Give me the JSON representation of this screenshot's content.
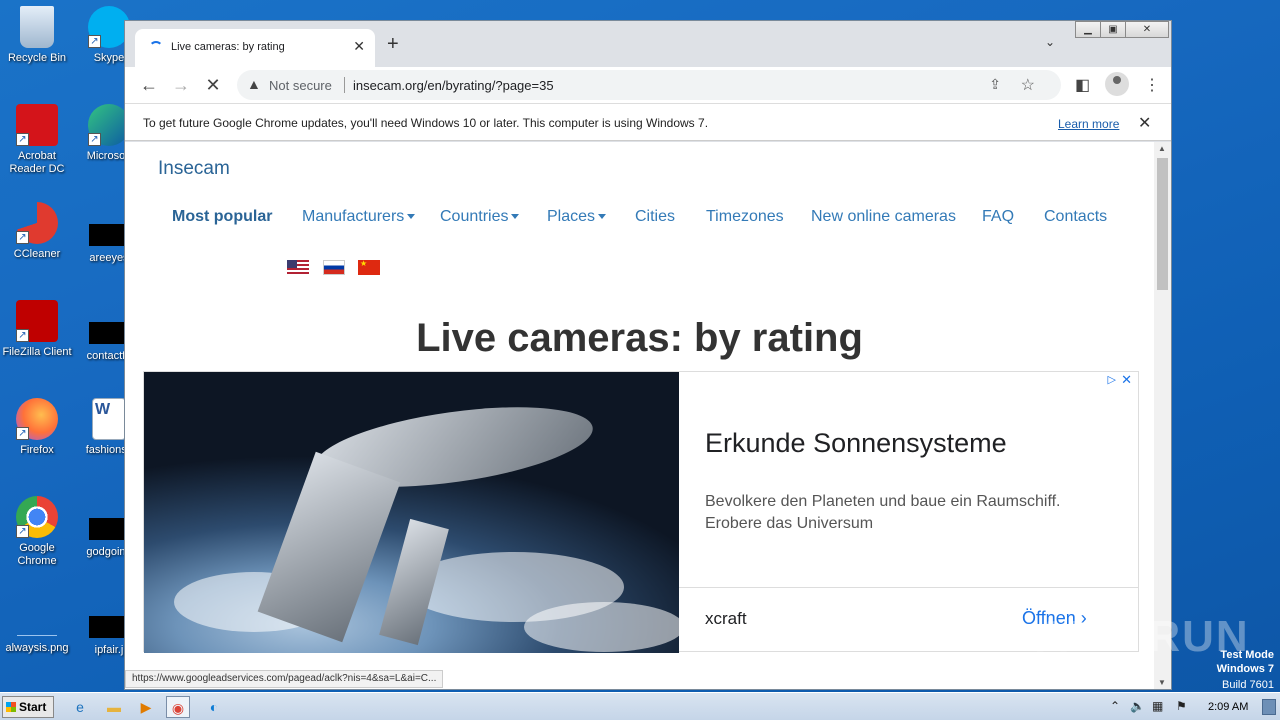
{
  "desktop": {
    "icons": [
      {
        "label": "Recycle Bin"
      },
      {
        "label": "Skype"
      },
      {
        "label": "Acrobat Reader DC"
      },
      {
        "label": "Microsoft"
      },
      {
        "label": "CCleaner"
      },
      {
        "label": "areeyes"
      },
      {
        "label": "FileZilla Client"
      },
      {
        "label": "contactfri"
      },
      {
        "label": "Firefox"
      },
      {
        "label": "fashionsy"
      },
      {
        "label": "Google Chrome"
      },
      {
        "label": "godgoing"
      },
      {
        "label": "alwaysis.png"
      },
      {
        "label": "ipfair.j"
      }
    ]
  },
  "browser": {
    "tab_title": "Live cameras: by rating",
    "security_label": "Not secure",
    "url": "insecam.org/en/byrating/?page=35",
    "infobar_message": "To get future Google Chrome updates, you'll need Windows 10 or later. This computer is using Windows 7.",
    "infobar_link": "Learn more",
    "status_url": "https://www.googleadservices.com/pagead/aclk?nis=4&sa=L&ai=C..."
  },
  "site": {
    "brand": "Insecam",
    "nav": [
      {
        "label": "Most popular"
      },
      {
        "label": "Manufacturers"
      },
      {
        "label": "Countries"
      },
      {
        "label": "Places"
      },
      {
        "label": "Cities"
      },
      {
        "label": "Timezones"
      },
      {
        "label": "New online cameras"
      },
      {
        "label": "FAQ"
      },
      {
        "label": "Contacts"
      }
    ],
    "heading": "Live cameras: by rating"
  },
  "ad": {
    "title": "Erkunde Sonnensysteme",
    "text": "Bevolkere den Planeten und baue ein Raumschiff. Erobere das Universum",
    "brand": "xcraft",
    "cta": "Öffnen"
  },
  "taskbar": {
    "start_label": "Start",
    "clock": "2:09 AM"
  },
  "watermark": {
    "text": "ANY RUN",
    "line1": "Test Mode",
    "line2": "Windows 7",
    "line3": "Build 7601"
  },
  "colors": {
    "desktop_bg": "#1769c0",
    "link_blue": "#337ab7",
    "ad_blue": "#1a73e8"
  }
}
